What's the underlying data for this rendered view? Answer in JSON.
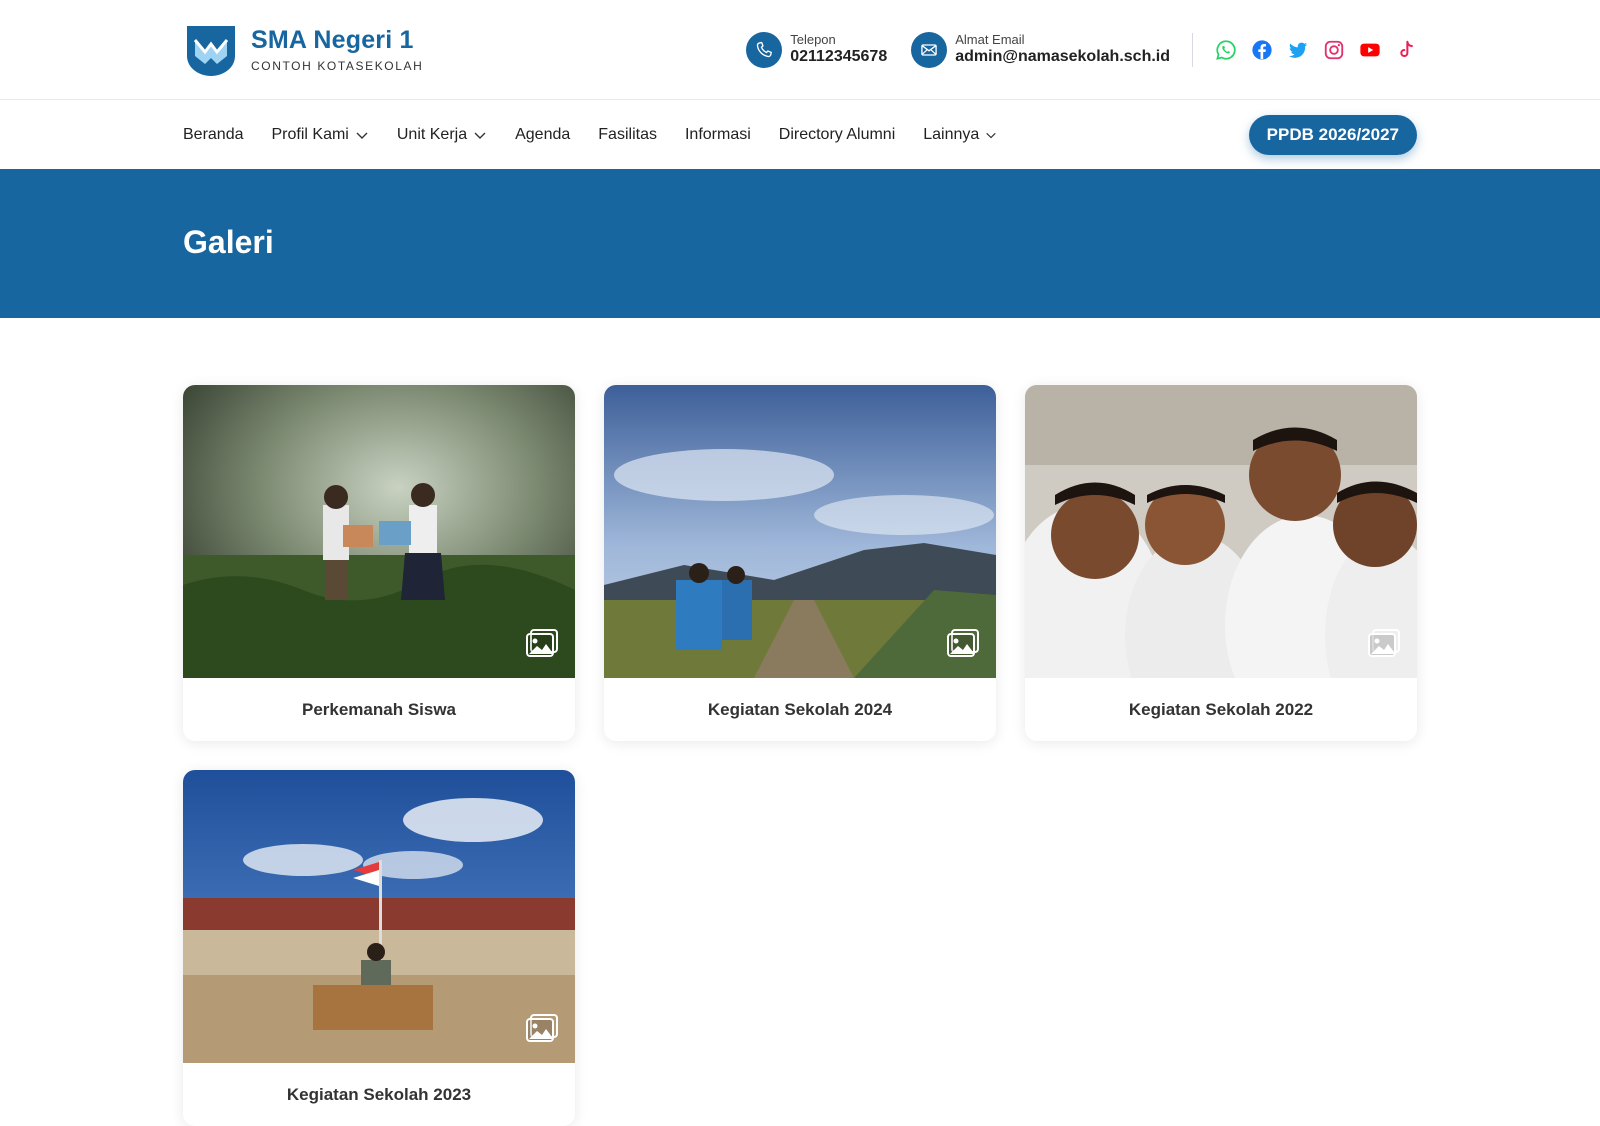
{
  "brand": {
    "name": "SMA Negeri 1",
    "subtitle": "CONTOH KOTASEKOLAH"
  },
  "contacts": {
    "phone": {
      "label": "Telepon",
      "value": "02112345678",
      "icon": "phone-icon"
    },
    "email": {
      "label": "Almat Email",
      "value": "admin@namasekolah.sch.id",
      "icon": "mail-icon"
    }
  },
  "socials": [
    "whatsapp-icon",
    "facebook-icon",
    "twitter-icon",
    "instagram-icon",
    "youtube-icon",
    "tiktok-icon"
  ],
  "nav": {
    "items": [
      {
        "label": "Beranda",
        "dropdown": false
      },
      {
        "label": "Profil Kami",
        "dropdown": true
      },
      {
        "label": "Unit Kerja",
        "dropdown": true
      },
      {
        "label": "Agenda",
        "dropdown": false
      },
      {
        "label": "Fasilitas",
        "dropdown": false
      },
      {
        "label": "Informasi",
        "dropdown": false
      },
      {
        "label": "Directory Alumni",
        "dropdown": false
      },
      {
        "label": "Lainnya",
        "dropdown": true
      }
    ],
    "cta": "PPDB 2026/2027"
  },
  "banner": {
    "title": "Galeri"
  },
  "gallery": {
    "items": [
      {
        "title": "Perkemanah Siswa"
      },
      {
        "title": "Kegiatan Sekolah 2024"
      },
      {
        "title": "Kegiatan Sekolah 2022"
      },
      {
        "title": "Kegiatan Sekolah 2023"
      }
    ]
  },
  "colors": {
    "primary": "#1866a0",
    "banner": "#1866a0",
    "text": "#222222"
  }
}
